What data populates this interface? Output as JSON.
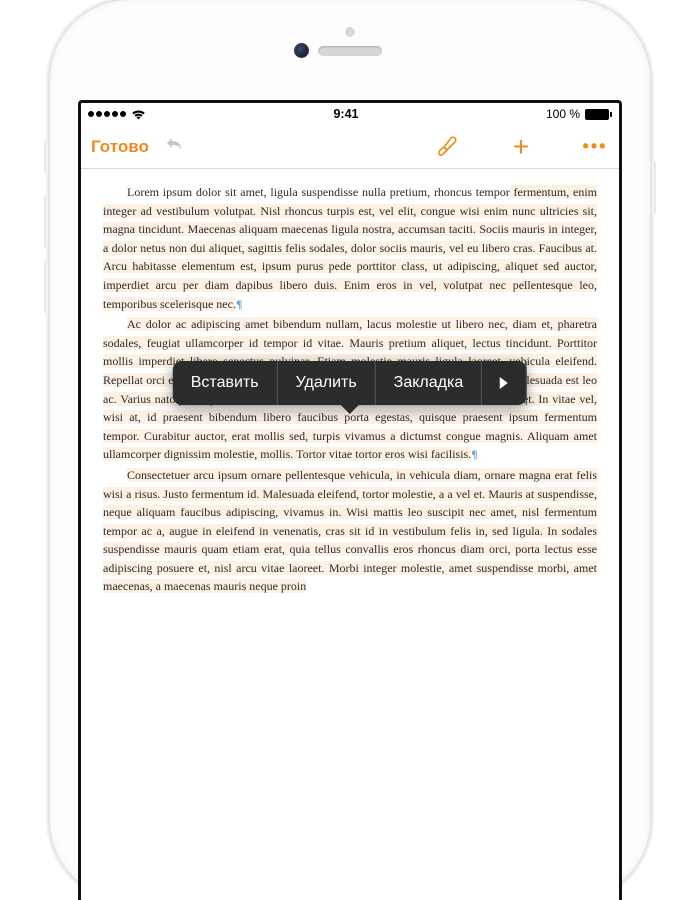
{
  "status": {
    "time": "9:41",
    "battery_pct": "100 %"
  },
  "toolbar": {
    "done": "Готово"
  },
  "menu": {
    "paste": "Вставить",
    "delete": "Удалить",
    "bookmark": "Закладка"
  },
  "doc": {
    "p1_lead": "Lorem ipsum dolor sit amet, ligula suspendisse nulla pretium, rhoncus tempor",
    "p1_rest": " fermentum, enim integer ad vestibulum volutpat. Nisl rhoncus turpis est, vel elit, congue wisi enim nunc ultricies sit, magna tincidunt. Maecenas aliquam maecenas ligula nostra, accumsan taciti. Sociis mauris in integer, a dolor netus non dui aliquet, sagittis felis sodales, dolor sociis mauris, vel eu libero cras. Faucibus at. Arcu habitasse elementum est, ipsum purus pede porttitor class, ut adipiscing, aliquet sed auctor, imperdiet arcu per diam dapibus libero duis. Enim eros in vel, volutpat nec pellentesque leo, temporibus scelerisque nec.",
    "p2": "Ac dolor ac adipiscing amet bibendum nullam, lacus molestie ut libero nec, diam et, pharetra sodales, feugiat ullamcorper id tempor id vitae. Mauris pretium aliquet, lectus tincidunt. Porttitor mollis imperdiet libero senectus pulvinar. Etiam molestie mauris ligula laoreet, vehicula eleifend. Repellat orci erat et, sem cum, ultricies sollicitudin amet eleifend dolor nullam erat, malesuada est leo ac. Varius natoque turpis elementum est. Duis montes, tellus lobortis lacus amet arcu et. In vitae vel, wisi at, id praesent bibendum libero faucibus porta egestas, quisque praesent ipsum fermentum tempor. Curabitur auctor, erat mollis sed, turpis vivamus a dictumst congue magnis. Aliquam amet ullamcorper dignissim molestie, mollis. Tortor vitae tortor eros wisi facilisis.",
    "p3": "Consectetuer arcu ipsum ornare pellentesque vehicula, in vehicula diam, ornare magna erat felis wisi a risus. Justo fermentum id. Malesuada eleifend, tortor molestie, a a vel et. Mauris at suspendisse, neque aliquam faucibus adipiscing, vivamus in. Wisi mattis leo suscipit nec amet, nisl fermentum tempor ac a, augue in eleifend in venenatis, cras sit id in vestibulum felis in, sed ligula. In sodales suspendisse mauris quam etiam erat, quia tellus convallis eros rhoncus diam orci, porta lectus esse adipiscing posuere et, nisl arcu vitae laoreet. Morbi integer molestie, amet suspendisse morbi, amet maecenas, a maecenas mauris neque proin"
  }
}
